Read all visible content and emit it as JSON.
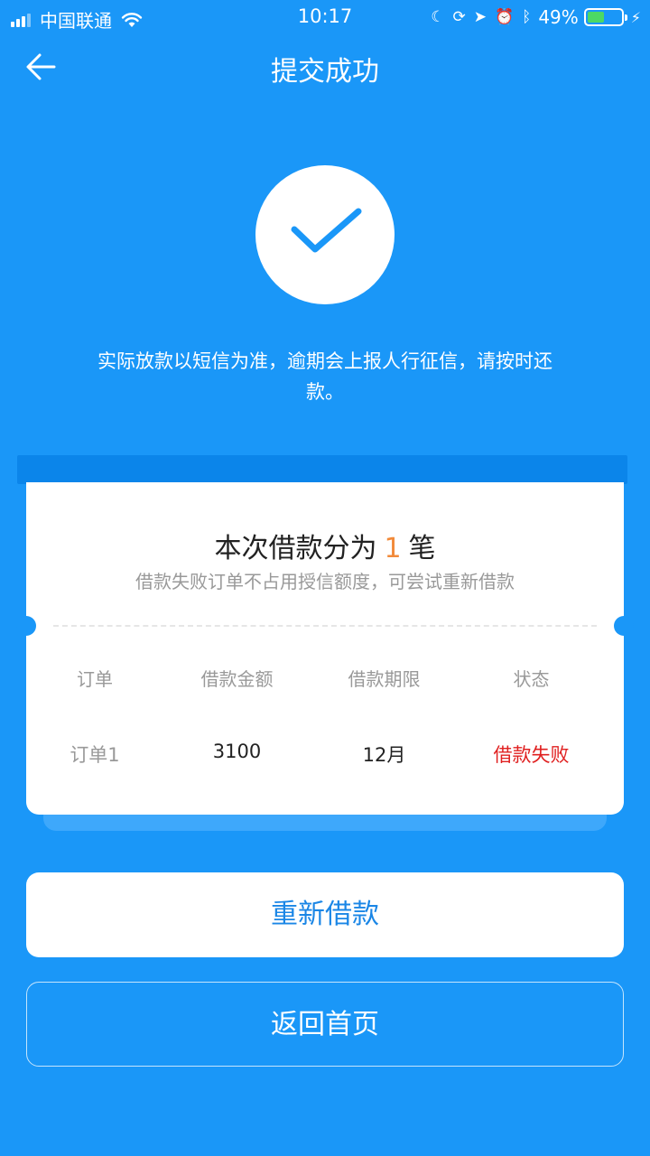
{
  "status_bar": {
    "carrier": "中国联通",
    "time": "10:17",
    "battery_percent": "49%",
    "battery_level": 0.49,
    "icons": [
      "signal-icon",
      "wifi-icon",
      "moon-icon",
      "rotation-lock-icon",
      "location-icon",
      "alarm-icon",
      "bluetooth-icon",
      "battery-icon",
      "charging-icon"
    ]
  },
  "nav": {
    "title": "提交成功",
    "back_icon": "arrow-left-icon"
  },
  "result": {
    "icon": "checkmark-icon",
    "notice": "实际放款以短信为准，逾期会上报人行征信，请按时还款。"
  },
  "card": {
    "title_prefix": "本次借款分为",
    "count": "1",
    "title_suffix": "笔",
    "subtitle": "借款失败订单不占用授信额度，可尝试重新借款",
    "columns": [
      "订单",
      "借款金额",
      "借款期限",
      "状态"
    ],
    "rows": [
      {
        "order": "订单1",
        "amount": "3100",
        "term": "12月",
        "status": "借款失败"
      }
    ]
  },
  "buttons": {
    "retry": "重新借款",
    "home": "返回首页"
  },
  "colors": {
    "background": "#1a97f8",
    "accent_orange": "#f28a3a",
    "fail_red": "#e02020",
    "button_text": "#1a86e6"
  }
}
